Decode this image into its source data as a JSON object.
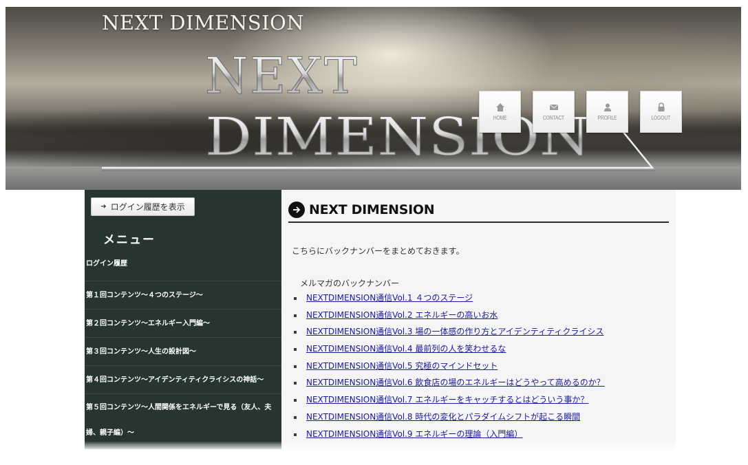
{
  "header": {
    "site_name": "NEXT DIMENSION",
    "logo_line1": "NEXT",
    "logo_line2": "DIMENSION",
    "nav": [
      {
        "label": "HOME",
        "icon": "home-icon"
      },
      {
        "label": "CONTACT",
        "icon": "mail-icon"
      },
      {
        "label": "PROFILE",
        "icon": "user-icon"
      },
      {
        "label": "LOGOUT",
        "icon": "lock-icon"
      }
    ]
  },
  "sidebar": {
    "login_history_button": "ログイン履歴を表示",
    "menu_title": "メニュー",
    "items": [
      "ログイン履歴",
      "第１回コンテンツ〜４つのステージ〜",
      "第２回コンテンツ〜エネルギー入門編〜",
      "第３回コンテンツ〜人生の設計図〜",
      "第４回コンテンツ〜アイデンティティクライシスの神話〜",
      "第５回コンテンツ〜人間関係をエネルギーで見る（友人、夫婦、親子編）〜"
    ]
  },
  "main": {
    "title": "NEXT DIMENSION",
    "intro": "こちらにバックナンバーをまとめておきます。",
    "backnumber_title": "メルマガのバックナンバー",
    "backnumbers": [
      "NEXTDIMENSION通信Vol.1 ４つのステージ",
      "NEXTDIMENSION通信Vol.2 エネルギーの高いお水",
      "NEXTDIMENSION通信Vol.3 場の一体感の作り方とアイデンティティクライシス",
      "NEXTDIMENSION通信Vol.4 最前列の人を笑わせるな",
      "NEXTDIMENSION通信Vol.5 究極のマインドセット",
      "NEXTDIMENSION通信Vol.6 飲食店の場のエネルギーはどうやって高めるのか？",
      "NEXTDIMENSION通信Vol.7 エネルギーをキャッチするとはどういう事か？",
      "NEXTDIMENSION通信Vol.8 時代の変化とパラダイムシフトが起こる瞬間",
      "NEXTDIMENSION通信Vol.9 エネルギーの理論（入門編）"
    ]
  },
  "colors": {
    "sidebar_bg": "#273530",
    "main_bg": "#f5f5f5",
    "link": "#1a1a9a"
  }
}
